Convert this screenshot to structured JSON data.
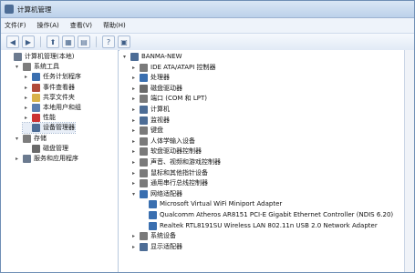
{
  "window": {
    "title": "计算机管理"
  },
  "menu": [
    "文件(F)",
    "操作(A)",
    "查看(V)",
    "帮助(H)"
  ],
  "left_tree": [
    {
      "label": "计算机管理(本地)",
      "level": 0,
      "exp": "",
      "icon": "#6b7a8f"
    },
    {
      "label": "系统工具",
      "level": 1,
      "exp": "▾",
      "icon": "#7d7d7d"
    },
    {
      "label": "任务计划程序",
      "level": 2,
      "exp": "▸",
      "icon": "#3a6fb0"
    },
    {
      "label": "事件查看器",
      "level": 2,
      "exp": "▸",
      "icon": "#b04a3a"
    },
    {
      "label": "共享文件夹",
      "level": 2,
      "exp": "▸",
      "icon": "#d8b24a"
    },
    {
      "label": "本地用户和组",
      "level": 2,
      "exp": "▸",
      "icon": "#5b7fb0"
    },
    {
      "label": "性能",
      "level": 2,
      "exp": "▸",
      "icon": "#c33"
    },
    {
      "label": "设备管理器",
      "level": 2,
      "exp": "",
      "icon": "#4d6d96",
      "selected": true
    },
    {
      "label": "存储",
      "level": 1,
      "exp": "▾",
      "icon": "#7d7d7d"
    },
    {
      "label": "磁盘管理",
      "level": 2,
      "exp": "",
      "icon": "#6a6a6a"
    },
    {
      "label": "服务和应用程序",
      "level": 1,
      "exp": "▸",
      "icon": "#6b7a8f"
    }
  ],
  "right_tree": [
    {
      "label": "BANMA-NEW",
      "level": 0,
      "exp": "▾",
      "icon": "#4d6d96"
    },
    {
      "label": "IDE ATA/ATAPI 控制器",
      "level": 1,
      "exp": "▸",
      "icon": "#7a7a7a"
    },
    {
      "label": "处理器",
      "level": 1,
      "exp": "▸",
      "icon": "#3a6fb0"
    },
    {
      "label": "磁盘驱动器",
      "level": 1,
      "exp": "▸",
      "icon": "#6a6a6a"
    },
    {
      "label": "端口 (COM 和 LPT)",
      "level": 1,
      "exp": "▸",
      "icon": "#7a7a7a"
    },
    {
      "label": "计算机",
      "level": 1,
      "exp": "▸",
      "icon": "#4d6d96"
    },
    {
      "label": "监视器",
      "level": 1,
      "exp": "▸",
      "icon": "#4d6d96"
    },
    {
      "label": "键盘",
      "level": 1,
      "exp": "▸",
      "icon": "#7a7a7a"
    },
    {
      "label": "人体学输入设备",
      "level": 1,
      "exp": "▸",
      "icon": "#7a7a7a"
    },
    {
      "label": "软盘驱动器控制器",
      "level": 1,
      "exp": "▸",
      "icon": "#7a7a7a"
    },
    {
      "label": "声音、视频和游戏控制器",
      "level": 1,
      "exp": "▸",
      "icon": "#7a7a7a"
    },
    {
      "label": "鼠标和其他指针设备",
      "level": 1,
      "exp": "▸",
      "icon": "#7a7a7a"
    },
    {
      "label": "通用串行总线控制器",
      "level": 1,
      "exp": "▸",
      "icon": "#7a7a7a"
    },
    {
      "label": "网络适配器",
      "level": 1,
      "exp": "▾",
      "icon": "#3a6fb0"
    },
    {
      "label": "Microsoft Virtual WiFi Miniport Adapter",
      "level": 2,
      "exp": "",
      "icon": "#3a6fb0"
    },
    {
      "label": "Qualcomm Atheros AR8151 PCI-E Gigabit Ethernet Controller (NDIS 6.20)",
      "level": 2,
      "exp": "",
      "icon": "#3a6fb0"
    },
    {
      "label": "Realtek RTL8191SU Wireless LAN 802.11n USB 2.0 Network Adapter",
      "level": 2,
      "exp": "",
      "icon": "#3a6fb0"
    },
    {
      "label": "系统设备",
      "level": 1,
      "exp": "▸",
      "icon": "#7a7a7a"
    },
    {
      "label": "显示适配器",
      "level": 1,
      "exp": "▸",
      "icon": "#4d6d96"
    }
  ]
}
